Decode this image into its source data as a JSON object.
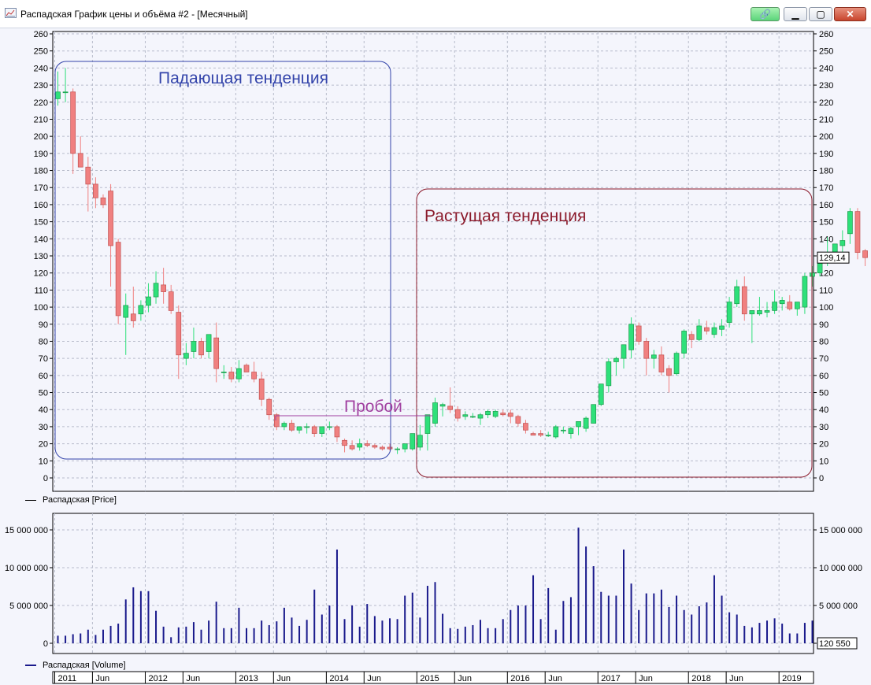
{
  "window": {
    "title": "Распадская График цены и объёма #2 - [Месячный]"
  },
  "price_axis": {
    "ticks": [
      "0",
      "10",
      "20",
      "30",
      "40",
      "50",
      "60",
      "70",
      "80",
      "90",
      "100",
      "110",
      "120",
      "130",
      "140",
      "150",
      "160",
      "170",
      "180",
      "190",
      "200",
      "210",
      "220",
      "230",
      "240",
      "250",
      "260"
    ]
  },
  "volume_axis": {
    "ticks": [
      "0",
      "5 000 000",
      "10 000 000",
      "15 000 000"
    ]
  },
  "time_axis": {
    "labels": [
      "2011",
      "Jun",
      "2012",
      "Jun",
      "2013",
      "Jun",
      "2014",
      "Jun",
      "2015",
      "Jun",
      "2016",
      "Jun",
      "2017",
      "Jun",
      "2018",
      "Jun",
      "2019"
    ]
  },
  "price_marker": {
    "value": "129,14"
  },
  "volume_marker": {
    "value": "120 550"
  },
  "legends": {
    "price": "Распадская [Price]",
    "volume": "Распадская [Volume]"
  },
  "annotations": {
    "falling": "Падающая тенденция",
    "rising": "Растущая тенденция",
    "breakout": "Пробой"
  },
  "colors": {
    "up": "#2ee07a",
    "down": "#f08080",
    "volume": "#1a1a8c",
    "falling_box": "#3344aa",
    "rising_box": "#8b1a2b",
    "breakout": "#a040a0"
  },
  "chart_data": [
    {
      "type": "candlestick",
      "series_name": "Распадская [Price]",
      "x_start": "2011-01",
      "interval": "month",
      "ylim": [
        0,
        260
      ],
      "ohlc": [
        [
          222,
          238,
          218,
          226
        ],
        [
          226,
          240,
          220,
          226
        ],
        [
          226,
          228,
          178,
          190
        ],
        [
          190,
          200,
          182,
          182
        ],
        [
          182,
          188,
          156,
          172
        ],
        [
          172,
          176,
          158,
          164
        ],
        [
          164,
          166,
          158,
          160
        ],
        [
          168,
          172,
          112,
          136
        ],
        [
          138,
          140,
          90,
          95
        ],
        [
          94,
          108,
          72,
          101
        ],
        [
          96,
          112,
          88,
          92
        ],
        [
          96,
          104,
          92,
          101
        ],
        [
          101,
          114,
          97,
          106
        ],
        [
          106,
          121,
          102,
          114
        ],
        [
          113,
          123,
          102,
          109
        ],
        [
          109,
          113,
          96,
          98
        ],
        [
          97,
          101,
          58,
          72
        ],
        [
          70,
          79,
          66,
          73
        ],
        [
          74,
          88,
          70,
          80
        ],
        [
          80,
          82,
          70,
          72
        ],
        [
          74,
          84,
          70,
          84
        ],
        [
          82,
          91,
          56,
          64
        ],
        [
          62,
          66,
          58,
          62
        ],
        [
          62,
          65,
          56,
          58
        ],
        [
          58,
          69,
          56,
          64
        ],
        [
          66,
          67,
          62,
          62
        ],
        [
          62,
          68,
          56,
          58
        ],
        [
          58,
          62,
          42,
          46
        ],
        [
          46,
          47,
          34,
          37
        ],
        [
          37,
          38,
          28,
          30
        ],
        [
          30,
          33,
          28,
          32
        ],
        [
          32,
          34,
          27,
          28
        ],
        [
          28,
          30,
          26,
          30
        ],
        [
          30,
          32,
          26,
          30
        ],
        [
          30,
          31,
          24,
          26
        ],
        [
          26,
          30,
          24,
          30
        ],
        [
          30,
          33,
          28,
          30
        ],
        [
          30,
          31,
          21,
          24
        ],
        [
          22,
          23,
          15,
          19
        ],
        [
          19,
          22,
          16,
          17
        ],
        [
          18,
          23,
          16,
          20
        ],
        [
          20,
          22,
          18,
          19
        ],
        [
          19,
          20,
          17,
          18
        ],
        [
          18,
          19,
          16,
          17
        ],
        [
          18,
          20,
          16,
          17
        ],
        [
          17,
          18,
          14,
          17
        ],
        [
          17,
          20,
          15,
          20
        ],
        [
          17,
          26,
          16,
          26
        ],
        [
          18,
          31,
          16,
          25
        ],
        [
          26,
          36,
          16,
          37
        ],
        [
          32,
          47,
          30,
          44
        ],
        [
          42,
          44,
          36,
          43
        ],
        [
          42,
          53,
          38,
          40
        ],
        [
          40,
          42,
          33,
          35
        ],
        [
          36,
          39,
          34,
          37
        ],
        [
          36,
          38,
          35,
          36
        ],
        [
          35,
          38,
          31,
          37
        ],
        [
          37,
          40,
          35,
          39
        ],
        [
          36,
          40,
          35,
          39
        ],
        [
          38,
          40,
          36,
          37
        ],
        [
          38,
          40,
          32,
          36
        ],
        [
          36,
          37,
          30,
          32
        ],
        [
          32,
          34,
          26,
          28
        ],
        [
          26,
          27,
          25,
          25
        ],
        [
          26,
          28,
          24,
          25
        ],
        [
          25,
          27,
          24,
          25
        ],
        [
          24,
          31,
          23,
          30
        ],
        [
          28,
          30,
          26,
          28
        ],
        [
          26,
          30,
          23,
          29
        ],
        [
          30,
          32,
          25,
          33
        ],
        [
          29,
          36,
          27,
          35
        ],
        [
          32,
          42,
          32,
          43
        ],
        [
          43,
          55,
          42,
          55
        ],
        [
          54,
          70,
          50,
          68
        ],
        [
          68,
          71,
          60,
          70
        ],
        [
          70,
          77,
          64,
          78
        ],
        [
          75,
          94,
          70,
          90
        ],
        [
          89,
          91,
          78,
          80
        ],
        [
          80,
          82,
          60,
          70
        ],
        [
          70,
          75,
          64,
          72
        ],
        [
          72,
          77,
          60,
          62
        ],
        [
          64,
          66,
          50,
          60
        ],
        [
          61,
          74,
          60,
          73
        ],
        [
          73,
          87,
          70,
          86
        ],
        [
          84,
          86,
          76,
          81
        ],
        [
          81,
          93,
          80,
          89
        ],
        [
          88,
          92,
          84,
          86
        ],
        [
          84,
          91,
          82,
          88
        ],
        [
          87,
          93,
          83,
          89
        ],
        [
          91,
          106,
          88,
          103
        ],
        [
          102,
          116,
          100,
          112
        ],
        [
          112,
          118,
          92,
          96
        ],
        [
          96,
          98,
          79,
          98
        ],
        [
          96,
          106,
          95,
          98
        ],
        [
          97,
          103,
          94,
          98
        ],
        [
          98,
          110,
          96,
          103
        ],
        [
          102,
          106,
          98,
          104
        ],
        [
          103,
          107,
          98,
          99
        ],
        [
          99,
          101,
          95,
          103
        ],
        [
          100,
          120,
          96,
          118
        ],
        [
          118,
          124,
          112,
          120
        ],
        [
          120,
          132,
          118,
          126
        ],
        [
          126,
          141,
          124,
          130
        ],
        [
          128,
          133,
          126,
          137
        ],
        [
          136,
          145,
          126,
          139
        ],
        [
          143,
          158,
          137,
          156
        ],
        [
          156,
          158,
          128,
          132
        ],
        [
          133,
          134,
          124,
          129
        ]
      ]
    },
    {
      "type": "bar",
      "series_name": "Распадская [Volume]",
      "x_start": "2011-01",
      "interval": "month",
      "ylim": [
        0,
        16000000
      ],
      "values": [
        1000000,
        1000000,
        1200000,
        1300000,
        1800000,
        1100000,
        1800000,
        2300000,
        2600000,
        5800000,
        7400000,
        6900000,
        6900000,
        4300000,
        2200000,
        800000,
        2100000,
        2200000,
        2800000,
        1800000,
        3000000,
        5500000,
        2000000,
        2000000,
        4700000,
        2000000,
        2000000,
        3000000,
        2400000,
        2900000,
        4700000,
        3400000,
        2300000,
        3100000,
        7100000,
        3800000,
        5000000,
        12400000,
        3200000,
        5000000,
        2200000,
        5200000,
        3600000,
        3000000,
        3300000,
        3200000,
        6300000,
        6700000,
        3400000,
        7600000,
        8100000,
        3900000,
        2000000,
        1900000,
        2200000,
        2400000,
        3100000,
        2000000,
        2000000,
        3200000,
        4400000,
        5000000,
        5000000,
        9000000,
        3200000,
        7300000,
        1800000,
        5600000,
        6100000,
        15300000,
        12800000,
        10200000,
        6800000,
        6300000,
        6300000,
        12400000,
        7900000,
        4400000,
        6600000,
        6600000,
        7100000,
        4800000,
        6300000,
        4400000,
        3800000,
        4900000,
        5400000,
        9000000,
        6300000,
        4100000,
        3800000,
        2300000,
        2100000,
        2700000,
        3000000,
        3300000,
        2600000,
        1300000,
        1300000,
        2700000,
        3000000,
        120550
      ]
    }
  ]
}
